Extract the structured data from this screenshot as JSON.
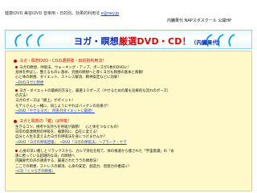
{
  "header": {
    "description": "健康iDVD 美容iDVD 音楽用・日的別。効果的利用法 ",
    "email": "e@ney.jp",
    "nav": [
      "内臓果代",
      "NAPスポスクール",
      "公開HP"
    ]
  },
  "banner": {
    "title_prefix": "ヨガ・瞑想",
    "title_highlight": "厳選DVD・CD！",
    "subtitle": "（内臓果代）"
  },
  "sections": [
    {
      "heading": "ヨガ・瞑想DVD・CDの選択肢・目的別利用法！",
      "lines": [
        "ヨガの瞑想、呼吸法、ウォーキング・アップ、ポーズが1枚のDVDに！",
        "身体を伸ばし、整えるものに基め、究極の瞑想へと導くヨガも瞑想の基本と真髄！",
        "心と体の瞑想、ダイエット、ストレス解消、精神安定などに効果！"
      ],
      "link": "→DVDヨガと瞑想"
    },
    {
      "heading": "",
      "lines": [
        "ヨガ・ダイエットの最終的方法と、厳選２０ポーズ（やせるための最も効果的な流れのポーズ）",
        "の方法！",
        "ヨガのポーズは「鍵上」がポイント！",
        "モデルさんと一緒に、同じようにやればバッグンの効果が！"
      ],
      "link": "→DVD『やせるヨガ』　時系列ダイエットに最適！"
    },
    {
      "heading": "ヨガと瞑想の「鍵」は呼吸！",
      "lines": [
        "生きるコツ、視考や気持ちを呼吸が調節！　心と体をつなぐもの！",
        "日常の発達瞑想の呼吸を、複雑的に、自在に変える！",
        "自分と人生を変える力ヨガの呼吸法を身につけませんか？"
      ],
      "link": "→DVD『ヨガの呼吸回復』　→DVD『ヨガの呼吸法』～プラーナ・ヤマ"
    },
    {
      "heading": "",
      "lines": [
        "心身の深い癒しとリラックスから、カルマ浄化を経て、体の根源から癒された「宇宙意識」の「永",
        "遠に甦っている超越的な日」の瞑想へ",
        "内臓果代の声の誘導する、厳選されたララの瞑想法！",
        "ここでの瞑想、ストレスの解消、心身の安定、創造力、直感力の養成に！"
      ],
      "link": "→CD『くつろぎの瞑想』"
    }
  ],
  "colors": {
    "accent_blue": "#0a2bb5",
    "accent_red": "#e10000",
    "content_bg": "#fff9c9",
    "banner_border": "#8fd2e8"
  }
}
